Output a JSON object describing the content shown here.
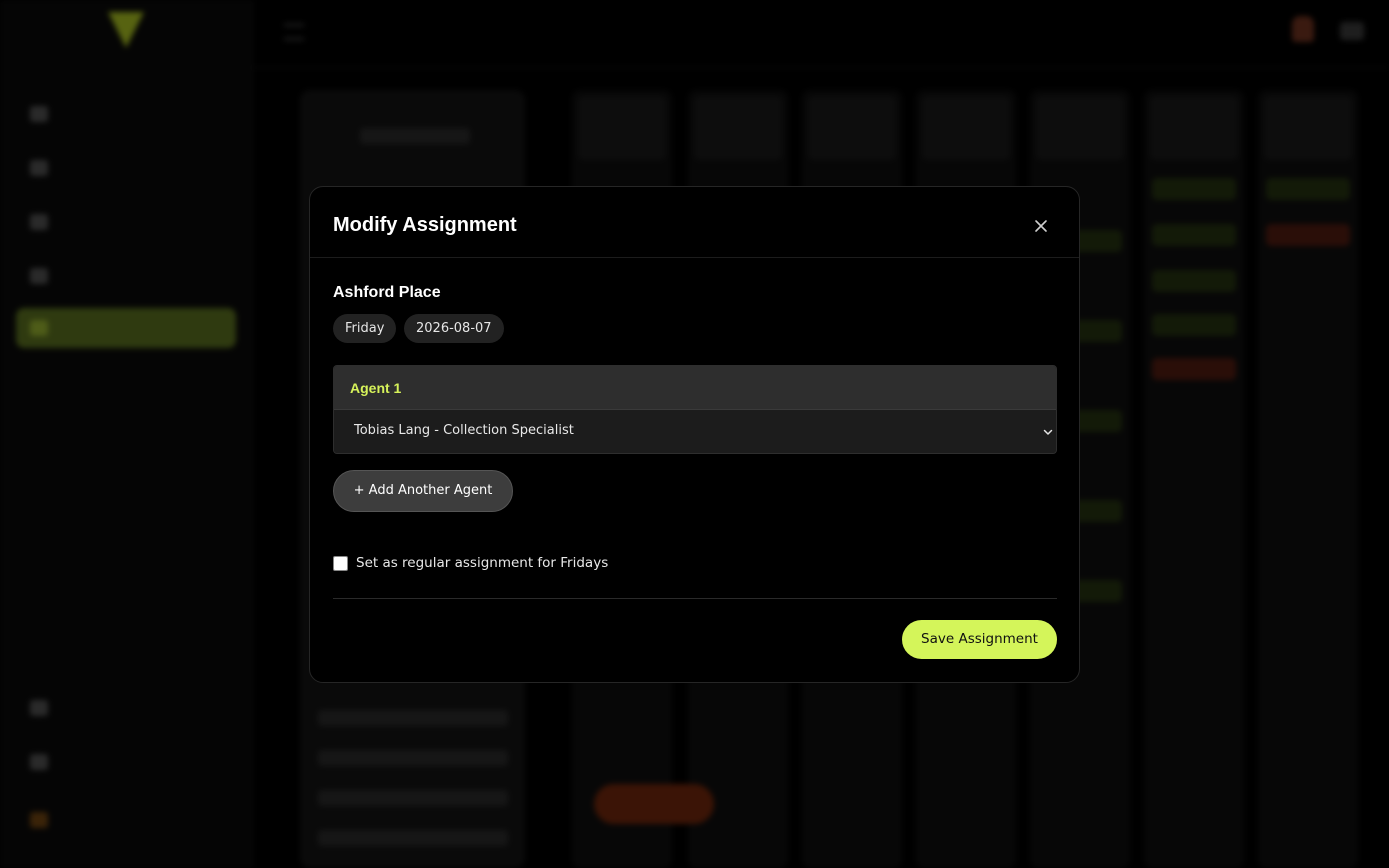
{
  "modal": {
    "title": "Modify Assignment",
    "close_icon": "close-icon",
    "location_name": "Ashford Place",
    "day_chip": "Friday",
    "date_chip": "2026-08-07",
    "agents": [
      {
        "label": "Agent 1",
        "selected_value": "Tobias Lang - Collection Specialist",
        "dropdown_icon": "chevron-down-icon"
      }
    ],
    "add_agent_label": "+ Add Another Agent",
    "regular_assignment": {
      "label": "Set as regular assignment for Fridays",
      "checked": false
    },
    "save_label": "Save Assignment"
  },
  "colors": {
    "accent": "#d4f55a",
    "agent_label": "#d6f25a",
    "modal_bg": "#000000",
    "card_header": "#2e2e2e",
    "add_button": "#3d3d3d"
  }
}
